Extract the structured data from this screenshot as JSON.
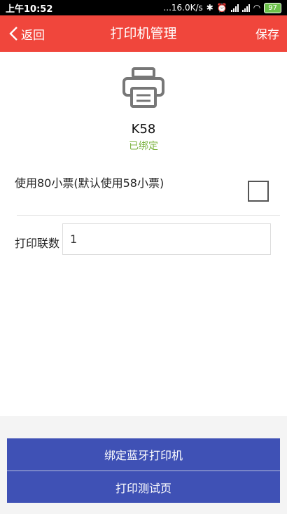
{
  "status_bar": {
    "time": "上午10:52",
    "net_speed": "...16.0K/s",
    "battery": "97"
  },
  "header": {
    "back_label": "返回",
    "title": "打印机管理",
    "save_label": "保存"
  },
  "printer": {
    "icon": "printer-icon",
    "name": "K58",
    "status": "已绑定"
  },
  "options": {
    "use_80_label": "使用80小票(默认使用58小票)",
    "use_80_checked": false,
    "copies_label": "打印联数",
    "copies_value": "1"
  },
  "actions": {
    "bind_label": "绑定蓝牙打印机",
    "test_label": "打印测试页"
  },
  "colors": {
    "app_bar": "#f0463c",
    "button": "#3f51b5",
    "bound_status": "#7cb342"
  }
}
